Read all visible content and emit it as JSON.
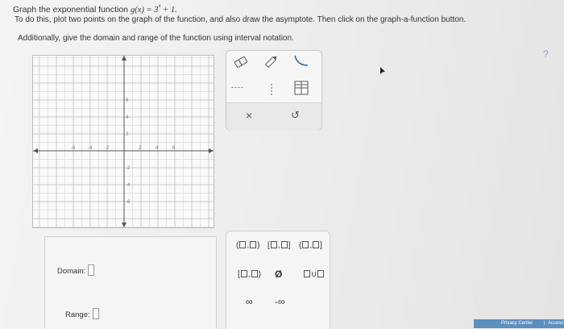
{
  "question": {
    "line1_prefix": "Graph the exponential function ",
    "function_lhs": "g(x)",
    "function_eq": " = 3",
    "function_exponent": "x",
    "function_tail": " + 1.",
    "line2": "To do this, plot two points on the graph of the function, and also draw the asymptote. Then click on the graph-a-function button.",
    "line3": "Additionally, give the domain and range of the function using interval notation."
  },
  "graph": {
    "x_tick_labels": [
      "-6",
      "-4",
      "-2",
      "2",
      "4",
      "6"
    ],
    "y_tick_labels": [
      "6",
      "4",
      "2",
      "-2",
      "-4",
      "-6"
    ]
  },
  "tools": {
    "eraser": "eraser-icon",
    "pencil": "pencil-icon",
    "graph_function": "graph-function-icon",
    "dashed_line": "----",
    "vertical_asymptote": "vertical-asymptote-icon",
    "function_table": "table-icon",
    "clear": "×",
    "undo": "↺"
  },
  "help": "?",
  "answers": {
    "domain_label": "Domain:",
    "range_label": "Range:"
  },
  "interval_buttons": {
    "open_open_l": "(",
    "open_open_sep": ",",
    "open_open_r": ")",
    "closed_closed_l": "[",
    "closed_closed_sep": ",",
    "closed_closed_r": "]",
    "open_closed_l": "(",
    "open_closed_sep": ",",
    "open_closed_r": "]",
    "closed_open_l": "[",
    "closed_open_sep": ",",
    "closed_open_r": ")",
    "empty_set": "Ø",
    "union": "∪",
    "infinity": "∞",
    "neg_infinity": "-∞"
  },
  "footer": {
    "privacy": "Privacy Center",
    "separator": "|",
    "accessibility": "Access"
  },
  "colors": {
    "accent": "#5b8fbd",
    "help": "#7aa3c8"
  }
}
